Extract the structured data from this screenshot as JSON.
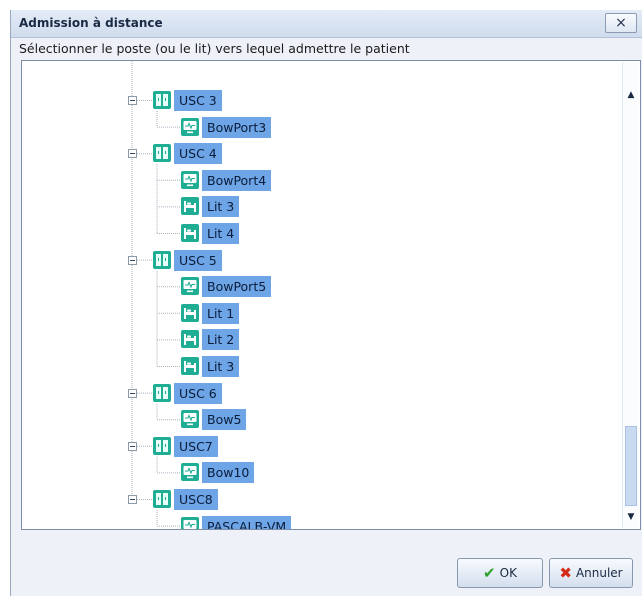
{
  "dialog": {
    "title": "Admission à distance",
    "close_glyph": "×",
    "instruction": "Sélectionner le poste (ou le lit) vers lequel admettre le patient"
  },
  "tree": {
    "groups": [
      {
        "label": "USC 3",
        "icon": "unit-icon",
        "children": [
          {
            "label": "BowPort3",
            "icon": "monitor-icon"
          }
        ]
      },
      {
        "label": "USC 4",
        "icon": "unit-icon",
        "children": [
          {
            "label": "BowPort4",
            "icon": "monitor-icon"
          },
          {
            "label": "Lit 3",
            "icon": "bed-icon"
          },
          {
            "label": "Lit 4",
            "icon": "bed-icon"
          }
        ]
      },
      {
        "label": "USC 5",
        "icon": "unit-icon",
        "children": [
          {
            "label": "BowPort5",
            "icon": "monitor-icon"
          },
          {
            "label": "Lit 1",
            "icon": "bed-icon"
          },
          {
            "label": "Lit 2",
            "icon": "bed-icon"
          },
          {
            "label": "Lit 3",
            "icon": "bed-icon"
          }
        ]
      },
      {
        "label": "USC 6",
        "icon": "unit-icon",
        "children": [
          {
            "label": "Bow5",
            "icon": "monitor-icon"
          }
        ]
      },
      {
        "label": "USC7",
        "icon": "unit-icon",
        "children": [
          {
            "label": "Bow10",
            "icon": "monitor-icon"
          }
        ]
      },
      {
        "label": "USC8",
        "icon": "unit-icon",
        "children": [
          {
            "label": "PASCALB-VM",
            "icon": "monitor-icon"
          }
        ]
      }
    ]
  },
  "scrollbar": {
    "up_glyph": "▲",
    "down_glyph": "▼"
  },
  "buttons": {
    "ok_label": "OK",
    "ok_icon": "✔",
    "cancel_label": "Annuler",
    "cancel_icon": "✖"
  },
  "colors": {
    "selection": "#6ea5e6",
    "icon_teal": "#1fae93",
    "ok_icon": "#2f9e2f",
    "cancel_icon": "#d42a1a"
  }
}
